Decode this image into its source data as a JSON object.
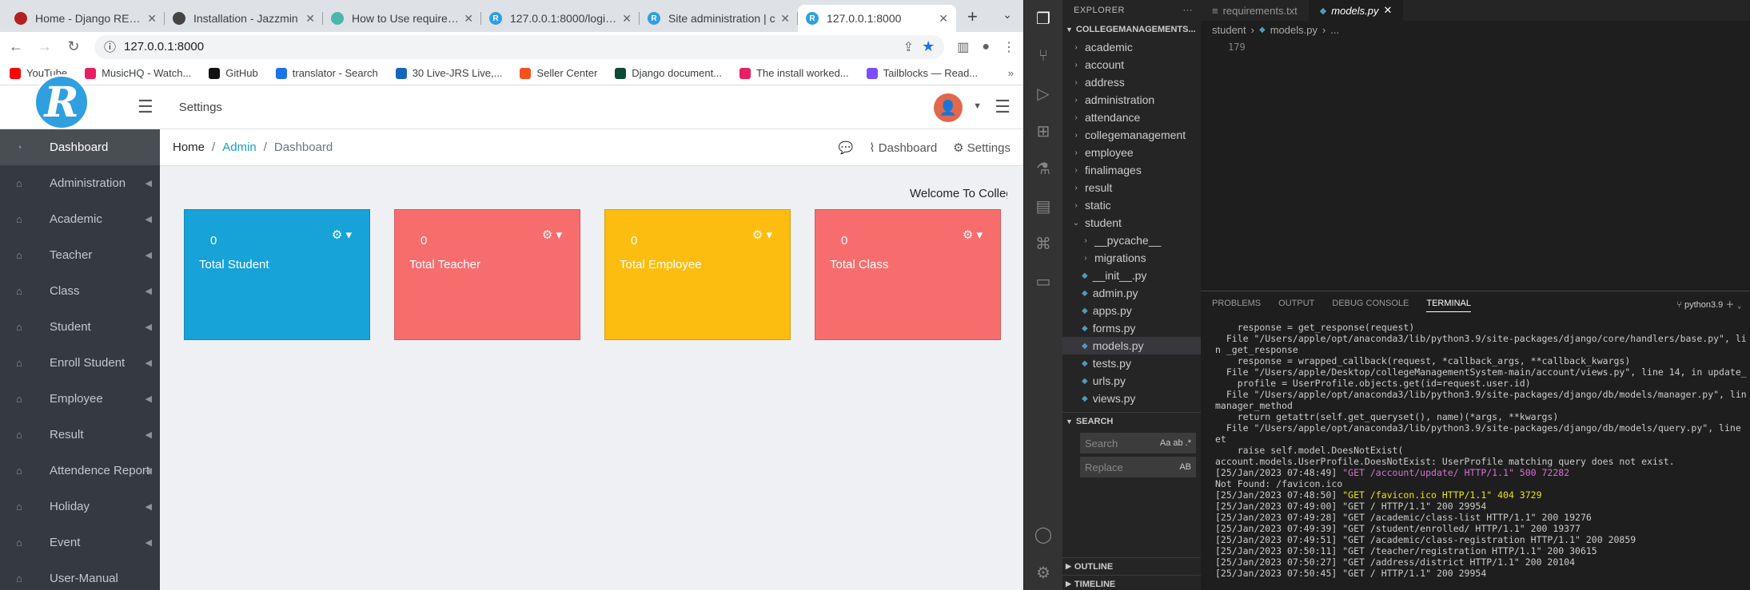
{
  "browser": {
    "tabs": [
      {
        "title": "Home - Django REST f",
        "color": "#b22222"
      },
      {
        "title": "Installation - Jazzmin",
        "color": "#444444"
      },
      {
        "title": "How to Use requireme",
        "color": "#4db6ac"
      },
      {
        "title": "127.0.0.1:8000/login?",
        "color": "#2f9fe0"
      },
      {
        "title": "Site administration | c",
        "color": "#2f9fe0"
      },
      {
        "title": "127.0.0.1:8000",
        "color": "#2f9fe0"
      }
    ],
    "url": "127.0.0.1:8000",
    "bookmarks": [
      {
        "label": "YouTube",
        "color": "#ff0000"
      },
      {
        "label": "MusicHQ - Watch...",
        "color": "#e91e63"
      },
      {
        "label": "GitHub",
        "color": "#111111"
      },
      {
        "label": "translator - Search",
        "color": "#1a73e8"
      },
      {
        "label": "30 Live-JRS Live,...",
        "color": "#1565c0"
      },
      {
        "label": "Seller Center",
        "color": "#f4511e"
      },
      {
        "label": "Django document...",
        "color": "#0c4b33"
      },
      {
        "label": "The install worked...",
        "color": "#e91e63"
      },
      {
        "label": "Tailblocks — Read...",
        "color": "#7c4dff"
      }
    ]
  },
  "admin": {
    "logo": "R",
    "top_settings": "Settings",
    "sidebar": [
      {
        "label": "Dashboard"
      },
      {
        "label": "Administration"
      },
      {
        "label": "Academic"
      },
      {
        "label": "Teacher"
      },
      {
        "label": "Class"
      },
      {
        "label": "Student"
      },
      {
        "label": "Enroll Student"
      },
      {
        "label": "Employee"
      },
      {
        "label": "Result"
      },
      {
        "label": "Attendence Report"
      },
      {
        "label": "Holiday"
      },
      {
        "label": "Event"
      },
      {
        "label": "User-Manual"
      }
    ],
    "breadcrumb": {
      "home": "Home",
      "admin": "Admin",
      "current": "Dashboard"
    },
    "right_links": {
      "dashboard": "Dashboard",
      "settings": "Settings"
    },
    "welcome": "Welcome To College",
    "cards": [
      {
        "value": "0",
        "label": "Total Student",
        "color": "#17a2d8"
      },
      {
        "value": "0",
        "label": "Total Teacher",
        "color": "#f76d6d"
      },
      {
        "value": "0",
        "label": "Total Employee",
        "color": "#fcbd10"
      },
      {
        "value": "0",
        "label": "Total Class",
        "color": "#f76d6d"
      }
    ]
  },
  "vscode": {
    "explorer_title": "EXPLORER",
    "project": "COLLEGEMANAGEMENTS...",
    "folders": [
      "academic",
      "account",
      "address",
      "administration",
      "attendance",
      "collegemanagement",
      "employee",
      "finalimages",
      "result",
      "static",
      "student"
    ],
    "student_children": [
      "__pycache__",
      "migrations"
    ],
    "student_files": [
      "__init__.py",
      "admin.py",
      "apps.py",
      "forms.py",
      "models.py",
      "tests.py",
      "urls.py",
      "views.py"
    ],
    "search_title": "SEARCH",
    "search_placeholder": "Search",
    "replace_placeholder": "Replace",
    "outline": "OUTLINE",
    "timeline": "TIMELINE",
    "editor_tabs": [
      "requirements.txt",
      "models.py"
    ],
    "breadcrumb": [
      "student",
      "models.py",
      "..."
    ],
    "line_number": "179",
    "panel_tabs": [
      "PROBLEMS",
      "OUTPUT",
      "DEBUG CONSOLE",
      "TERMINAL"
    ],
    "terminal_shell": "python3.9",
    "terminal_lines": [
      {
        "text": "    response = get_response(request)",
        "color": ""
      },
      {
        "text": "  File \"/Users/apple/opt/anaconda3/lib/python3.9/site-packages/django/core/handlers/base.py\", li",
        "color": ""
      },
      {
        "text": "n _get_response",
        "color": ""
      },
      {
        "text": "    response = wrapped_callback(request, *callback_args, **callback_kwargs)",
        "color": ""
      },
      {
        "text": "  File \"/Users/apple/Desktop/collegeManagementSystem-main/account/views.py\", line 14, in update_",
        "color": ""
      },
      {
        "text": "    profile = UserProfile.objects.get(id=request.user.id)",
        "color": ""
      },
      {
        "text": "  File \"/Users/apple/opt/anaconda3/lib/python3.9/site-packages/django/db/models/manager.py\", lin",
        "color": ""
      },
      {
        "text": "manager_method",
        "color": ""
      },
      {
        "text": "    return getattr(self.get_queryset(), name)(*args, **kwargs)",
        "color": ""
      },
      {
        "text": "  File \"/Users/apple/opt/anaconda3/lib/python3.9/site-packages/django/db/models/query.py\", line",
        "color": ""
      },
      {
        "text": "et",
        "color": ""
      },
      {
        "text": "    raise self.model.DoesNotExist(",
        "color": ""
      },
      {
        "text": "account.models.UserProfile.DoesNotExist: UserProfile matching query does not exist.",
        "color": ""
      },
      {
        "text": "[25/Jan/2023 07:48:49] \"GET /account/update/ HTTP/1.1\" 500 72282",
        "color": "mag"
      },
      {
        "text": "Not Found: /favicon.ico",
        "color": ""
      },
      {
        "text": "[25/Jan/2023 07:48:50] \"GET /favicon.ico HTTP/1.1\" 404 3729",
        "color": "ylw"
      },
      {
        "text": "[25/Jan/2023 07:49:00] \"GET / HTTP/1.1\" 200 29954",
        "color": ""
      },
      {
        "text": "[25/Jan/2023 07:49:28] \"GET /academic/class-list HTTP/1.1\" 200 19276",
        "color": ""
      },
      {
        "text": "[25/Jan/2023 07:49:39] \"GET /student/enrolled/ HTTP/1.1\" 200 19377",
        "color": ""
      },
      {
        "text": "[25/Jan/2023 07:49:51] \"GET /academic/class-registration HTTP/1.1\" 200 20859",
        "color": ""
      },
      {
        "text": "[25/Jan/2023 07:50:11] \"GET /teacher/registration HTTP/1.1\" 200 30615",
        "color": ""
      },
      {
        "text": "[25/Jan/2023 07:50:27] \"GET /address/district HTTP/1.1\" 200 20104",
        "color": ""
      },
      {
        "text": "[25/Jan/2023 07:50:45] \"GET / HTTP/1.1\" 200 29954",
        "color": ""
      }
    ]
  }
}
